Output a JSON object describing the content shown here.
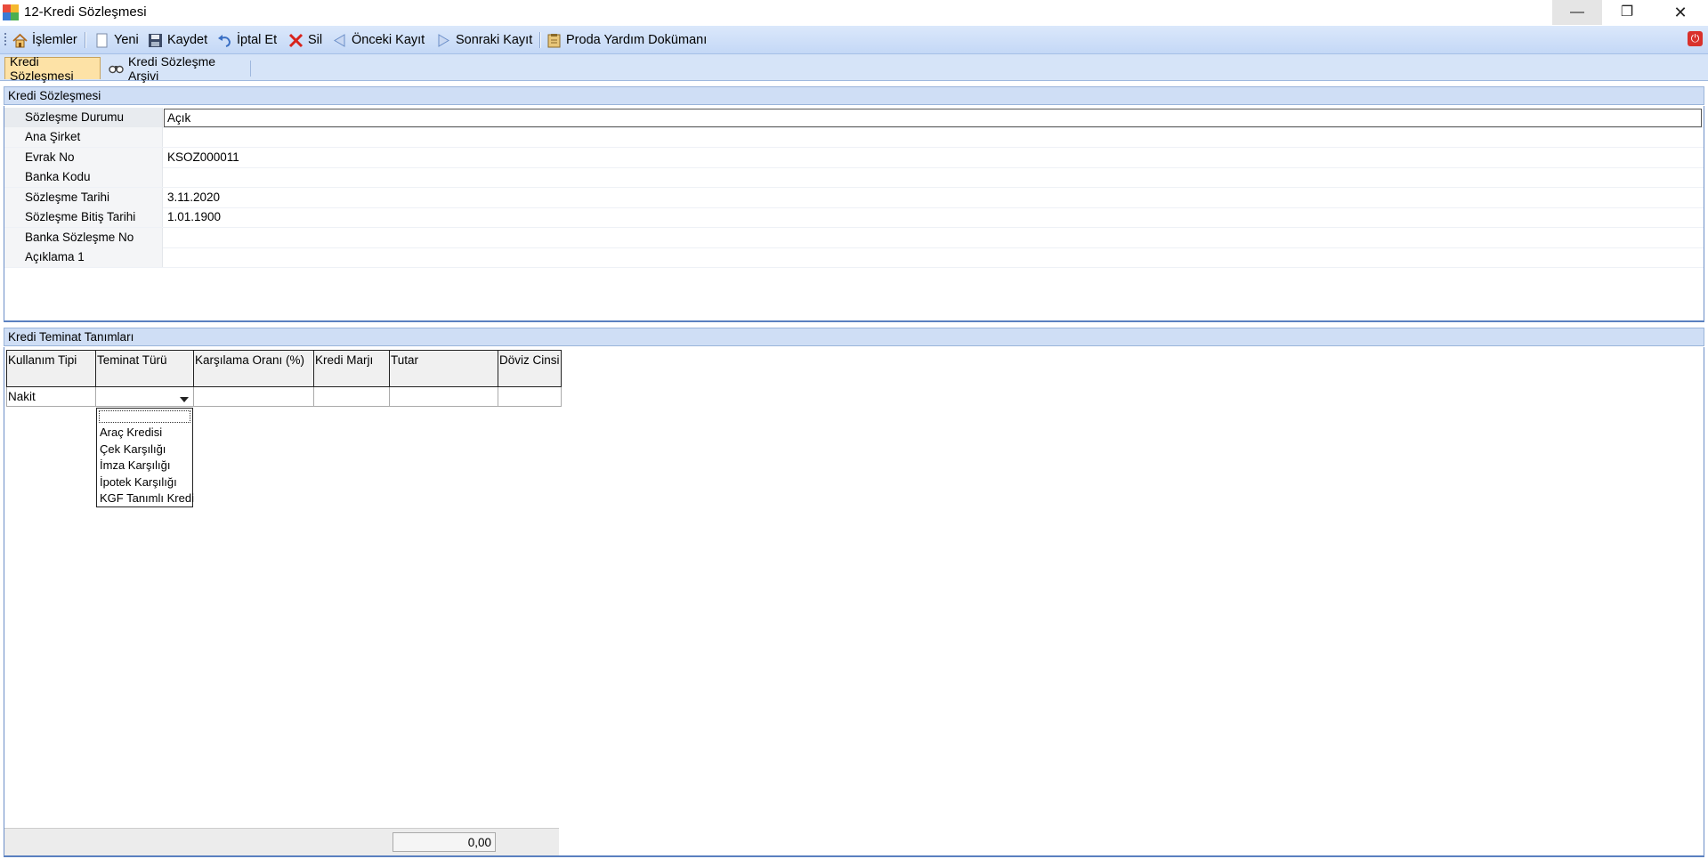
{
  "window": {
    "title": "12-Kredi Sözleşmesi"
  },
  "toolbar": {
    "items": [
      {
        "label": "İşlemler",
        "icon": "home-icon"
      },
      {
        "label": "Yeni",
        "icon": "new-document-icon"
      },
      {
        "label": "Kaydet",
        "icon": "save-icon"
      },
      {
        "label": "İptal Et",
        "icon": "undo-icon"
      },
      {
        "label": "Sil",
        "icon": "delete-icon"
      },
      {
        "label": "Önceki Kayıt",
        "icon": "previous-icon"
      },
      {
        "label": "Sonraki Kayıt",
        "icon": "next-icon"
      },
      {
        "label": "Proda Yardım Dokümanı",
        "icon": "help-document-icon"
      }
    ]
  },
  "tabs": [
    {
      "label": "Kredi Sözleşmesi",
      "active": true
    },
    {
      "label": "Kredi Sözleşme Arşivi",
      "active": false,
      "icon": "binoculars-icon"
    }
  ],
  "contract_section": {
    "title": "Kredi Sözleşmesi",
    "fields": [
      {
        "label": "Sözleşme Durumu",
        "value": "Açık"
      },
      {
        "label": "Ana Şirket",
        "value": ""
      },
      {
        "label": "Evrak No",
        "value": "KSOZ000011"
      },
      {
        "label": "Banka Kodu",
        "value": ""
      },
      {
        "label": "Sözleşme Tarihi",
        "value": "3.11.2020"
      },
      {
        "label": "Sözleşme Bitiş Tarihi",
        "value": "1.01.1900"
      },
      {
        "label": "Banka Sözleşme No",
        "value": ""
      },
      {
        "label": "Açıklama 1",
        "value": ""
      }
    ]
  },
  "guarantee_section": {
    "title": "Kredi Teminat Tanımları",
    "columns": [
      "Kullanım Tipi",
      "Teminat Türü",
      "Karşılama Oranı (%)",
      "Kredi Marjı",
      "Tutar",
      "Döviz Cinsi"
    ],
    "rows": [
      {
        "cells": [
          "Nakit",
          "",
          "",
          "",
          "",
          ""
        ]
      }
    ],
    "dropdown_options": [
      "Araç Kredisi",
      "Çek Karşılığı",
      "İmza Karşılığı",
      "İpotek Karşılığı",
      "KGF Tanımlı Kredi"
    ],
    "total": "0,00"
  },
  "colors": {
    "toolbar_bg": "#c4d8f6",
    "active_tab": "#fde2a6",
    "close_power": "#d9312b"
  }
}
